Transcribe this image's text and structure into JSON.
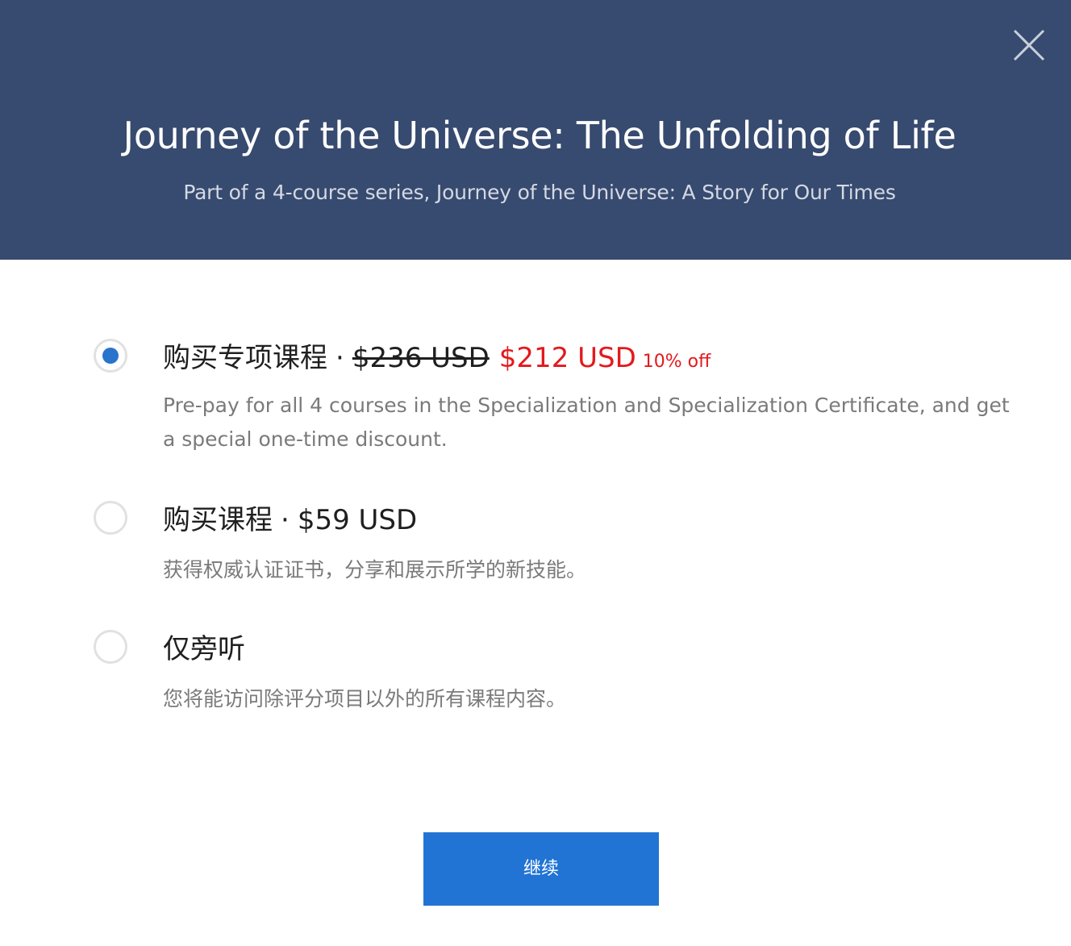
{
  "header": {
    "title": "Journey of the Universe: The Unfolding of Life",
    "subtitle": "Part of a 4-course series, Journey of the Universe: A Story for Our Times",
    "close_icon": "close-icon"
  },
  "colors": {
    "header_bg": "#374a6f",
    "accent": "#2a73cc",
    "button_bg": "#2174d4",
    "sale_red": "#e4191d"
  },
  "options": [
    {
      "label": "购买专项课程",
      "separator": "·",
      "original_price": "$236 USD",
      "sale_price": "$212 USD",
      "discount": "10% off",
      "description": "Pre-pay for all 4 courses in the Specialization and Specialization Certificate, and get a special one-time discount.",
      "selected": true
    },
    {
      "label": "购买课程",
      "separator": "·",
      "price": "$59 USD",
      "description": "获得权威认证证书，分享和展示所学的新技能。",
      "selected": false
    },
    {
      "label": "仅旁听",
      "description": "您将能访问除评分项目以外的所有课程内容。",
      "selected": false
    }
  ],
  "continue_label": "继续"
}
